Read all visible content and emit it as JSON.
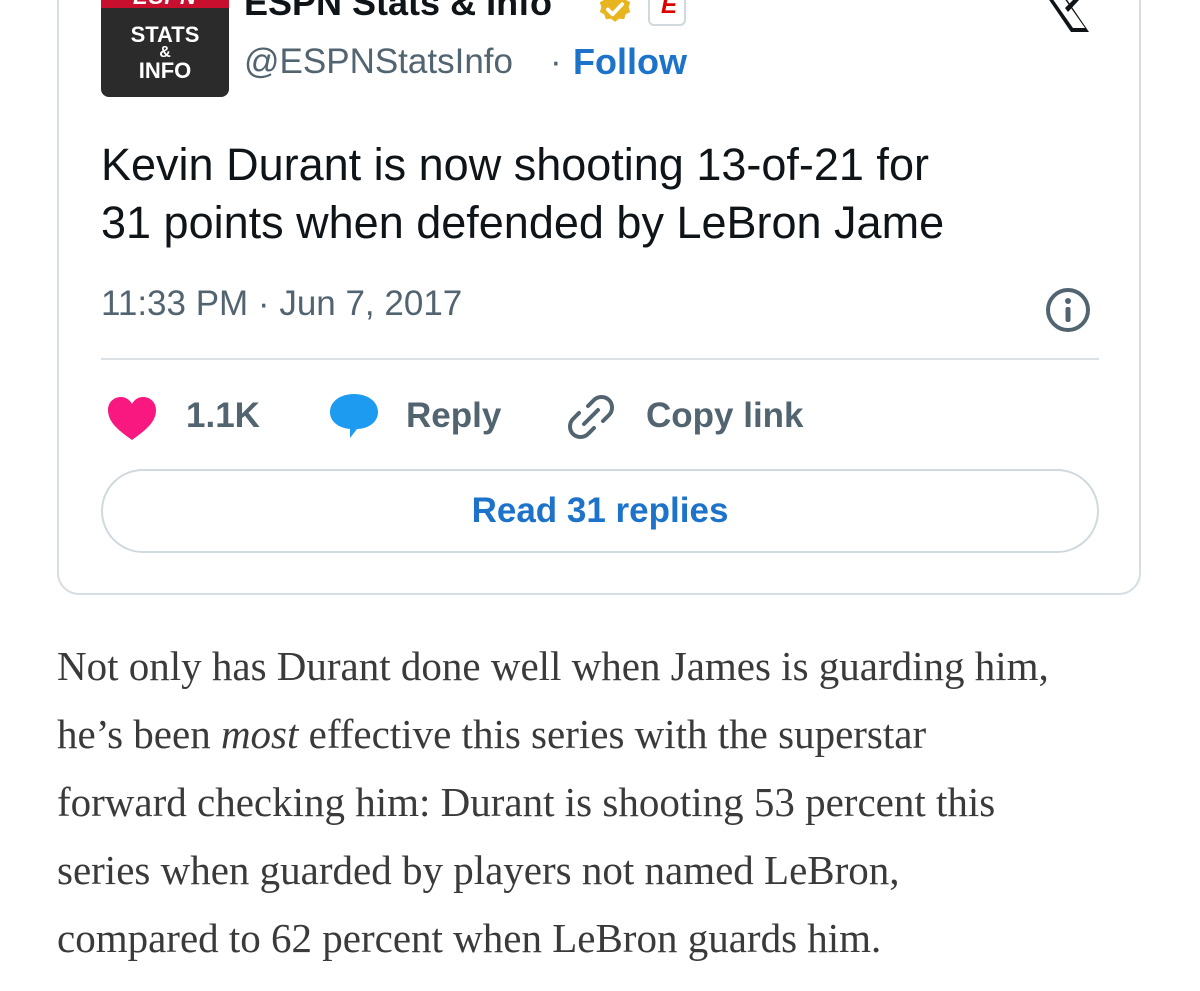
{
  "tweet": {
    "author_name": "ESPN Stats & Info",
    "handle": "@ESPNStatsInfo",
    "separator": "·",
    "follow_label": "Follow",
    "avatar": {
      "top": "ESPN",
      "line1": "STATS",
      "line2": "&",
      "line3": "INFO"
    },
    "badge_letter": "E",
    "text_line1": "Kevin Durant is now shooting 13-of-21 for",
    "text_line2": "31 points when defended by LeBron Jame",
    "timestamp": "11:33 PM · Jun 7, 2017",
    "likes": "1.1K",
    "reply_label": "Reply",
    "copy_link_label": "Copy link",
    "read_replies_label": "Read 31 replies"
  },
  "article": {
    "line1": "Not only has Durant done well when James is guarding him,",
    "line2_pre": "he’s been ",
    "line2_em": "most",
    "line2_post": " effective this series with the superstar",
    "line3": "forward checking him: Durant is shooting 53 percent this",
    "line4": "series when guarded by players not named LeBron,",
    "line5": "compared to 62 percent when LeBron guards him."
  },
  "colors": {
    "accent": "#1d73c9",
    "heart": "#f91880",
    "reply": "#1d9bf0",
    "verified": "#e8b520",
    "espn_red": "#c8102e"
  }
}
